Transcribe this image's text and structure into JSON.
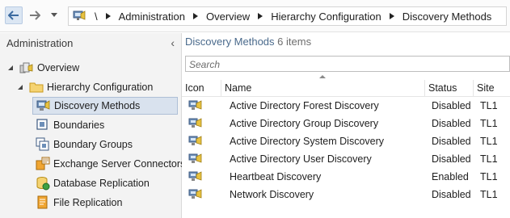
{
  "breadcrumb": {
    "root": "\\",
    "items": [
      "Administration",
      "Overview",
      "Hierarchy Configuration",
      "Discovery Methods"
    ]
  },
  "left_pane": {
    "header": "Administration",
    "collapse_glyph": "‹",
    "tree": [
      {
        "label": "Overview",
        "icon": "overview-icon"
      },
      {
        "label": "Hierarchy Configuration",
        "icon": "folder-icon"
      },
      {
        "label": "Discovery Methods",
        "icon": "discovery-methods-icon"
      },
      {
        "label": "Boundaries",
        "icon": "boundaries-icon"
      },
      {
        "label": "Boundary Groups",
        "icon": "boundary-groups-icon"
      },
      {
        "label": "Exchange Server Connectors",
        "icon": "exchange-connector-icon"
      },
      {
        "label": "Database Replication",
        "icon": "database-replication-icon"
      },
      {
        "label": "File Replication",
        "icon": "file-replication-icon"
      }
    ]
  },
  "list": {
    "title": "Discovery Methods",
    "count": "6 items",
    "search_placeholder": "Search",
    "columns": [
      "Icon",
      "Name",
      "Status",
      "Site"
    ],
    "rows": [
      {
        "name": "Active Directory Forest Discovery",
        "status": "Disabled",
        "site": "TL1"
      },
      {
        "name": "Active Directory Group Discovery",
        "status": "Disabled",
        "site": "TL1"
      },
      {
        "name": "Active Directory System Discovery",
        "status": "Disabled",
        "site": "TL1"
      },
      {
        "name": "Active Directory User Discovery",
        "status": "Disabled",
        "site": "TL1"
      },
      {
        "name": "Heartbeat Discovery",
        "status": "Enabled",
        "site": "TL1"
      },
      {
        "name": "Network Discovery",
        "status": "Disabled",
        "site": "TL1"
      }
    ]
  },
  "colors": {
    "selection": "#d9e2ee",
    "pane_bg": "#f3f3f3",
    "title_blue": "#4a6a8c"
  }
}
